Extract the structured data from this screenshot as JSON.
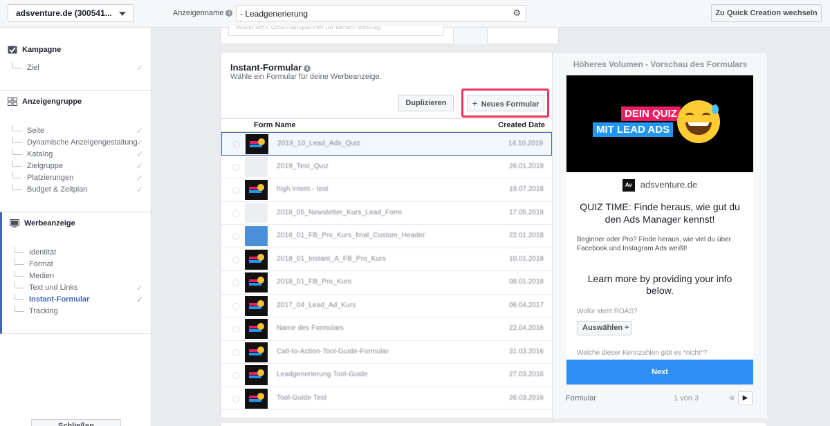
{
  "topbar": {
    "account": "adsventure.de (300541...",
    "adname_label": "Anzeigenname",
    "adname_value": "- Leadgenerierung",
    "quick_creation": "Zu Quick Creation wechseln"
  },
  "sidebar": {
    "campaign": {
      "title": "Kampagne",
      "items": [
        {
          "label": "Ziel",
          "done": true
        }
      ]
    },
    "adset": {
      "title": "Anzeigengruppe",
      "items": [
        {
          "label": "Seite"
        },
        {
          "label": "Dynamische Anzeigengestaltung"
        },
        {
          "label": "Katalog"
        },
        {
          "label": "Zielgruppe"
        },
        {
          "label": "Platzierungen"
        },
        {
          "label": "Budget & Zeitplan"
        }
      ]
    },
    "ad": {
      "title": "Werbeanzeige",
      "items": [
        {
          "label": "Identität"
        },
        {
          "label": "Format"
        },
        {
          "label": "Medien"
        },
        {
          "label": "Text und Links"
        },
        {
          "label": "Instant-Formular"
        },
        {
          "label": "Tracking"
        }
      ]
    },
    "close": "Schließen"
  },
  "top_card": {
    "field_text": "Wählt dem Geschäftspartner für diesen Beitrag."
  },
  "form_card": {
    "title": "Instant-Formular",
    "subtitle": "Wähle ein Formular für deine Werbeanzeige.",
    "duplicate": "Duplizieren",
    "new_form": "Neues Formular",
    "columns": {
      "name": "Form Name",
      "date": "Created Date"
    },
    "rows": [
      {
        "name": "2019_10_Lead_Ads_Quiz",
        "date": "14.10.2019"
      },
      {
        "name": "2019_Test_Quiz",
        "date": "26.01.2019"
      },
      {
        "name": "high intent - test",
        "date": "19.07.2018"
      },
      {
        "name": "2018_05_Newsletter_Kurs_Lead_Form",
        "date": "17.05.2018"
      },
      {
        "name": "2018_01_FB_Pro_Kurs_final_Custom_Header",
        "date": "22.01.2018"
      },
      {
        "name": "2018_01_Instant_A_FB_Pro_Kurs",
        "date": "10.01.2018"
      },
      {
        "name": "2018_01_FB_Pro_Kurs",
        "date": "08.01.2018"
      },
      {
        "name": "2017_04_Lead_Ad_Kurs",
        "date": "06.04.2017"
      },
      {
        "name": "Name des Formulars",
        "date": "22.04.2016"
      },
      {
        "name": "Call-to-Action-Tool-Guide-Formular",
        "date": "31.03.2016"
      },
      {
        "name": "Leadgenerierung Tool-Guide",
        "date": "27.03.2016"
      },
      {
        "name": "Tool-Guide Test",
        "date": "26.03.2016"
      }
    ]
  },
  "preview": {
    "title": "Höheres Volumen - Vorschau des Formulars",
    "hero_line1": "DEIN QUIZ",
    "hero_line2": "MIT LEAD ADS",
    "brand_logo": "Av",
    "brand": "adsventure.de",
    "headline": "QUIZ TIME: Finde heraus, wie gut du den Ads Manager kennst!",
    "description": "Beginner oder Pro? Finde heraus, wie viel du über Facebook und Instagram Ads weißt!",
    "learn_more": "Learn more by providing your info below.",
    "question1": "Wofür steht ROAS?",
    "select": "Auswählen ÷",
    "question2": "Welche dieser Kennzahlen gibt es *nicht*?",
    "next": "Next",
    "footer_label": "Formular",
    "page": "1 von 3"
  }
}
